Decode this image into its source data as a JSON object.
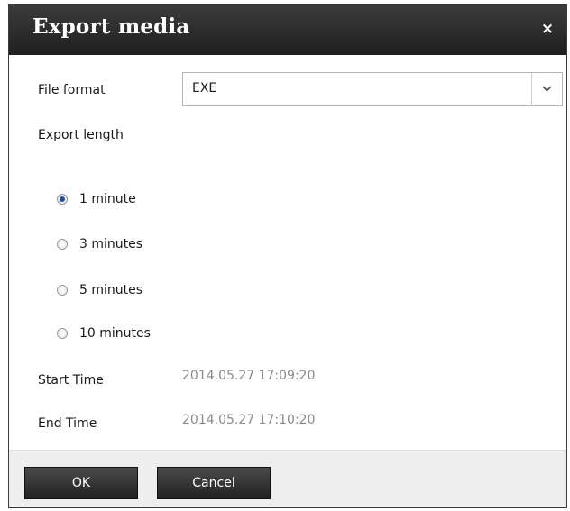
{
  "dialog": {
    "title": "Export media",
    "close_glyph": "×"
  },
  "file_format": {
    "label": "File format",
    "value": "EXE",
    "arrow_icon": "chevron-down-icon"
  },
  "export_length": {
    "label": "Export length",
    "options": [
      {
        "label": "1 minute",
        "checked": true
      },
      {
        "label": "3 minutes",
        "checked": false
      },
      {
        "label": "5 minutes",
        "checked": false
      },
      {
        "label": "10 minutes",
        "checked": false
      }
    ]
  },
  "start_time": {
    "label": "Start Time",
    "value": "2014.05.27 17:09:20"
  },
  "end_time": {
    "label": "End Time",
    "value": "2014.05.27 17:10:20"
  },
  "buttons": {
    "ok": "OK",
    "cancel": "Cancel"
  },
  "colors": {
    "titlebar": "#2b2b2b",
    "button": "#333333",
    "radio_selected": "#2a4d9a",
    "time_value": "#8a8a8a"
  }
}
